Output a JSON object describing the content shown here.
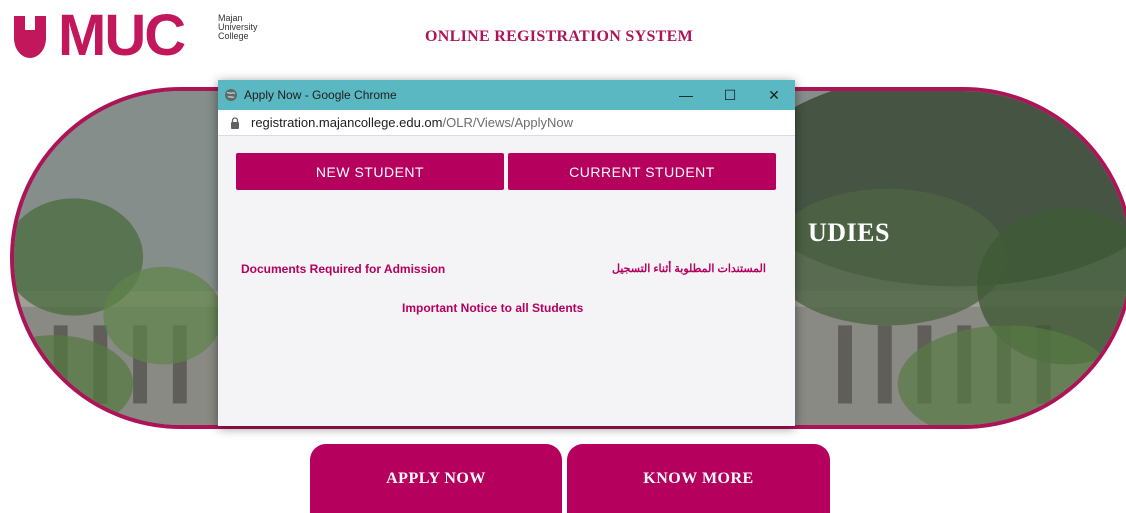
{
  "header": {
    "logo_text": "MUC",
    "logo_sub": [
      "Majan",
      "University",
      "College"
    ],
    "site_title": "ONLINE REGISTRATION SYSTEM"
  },
  "banner": {
    "heading_partial": "UDIES"
  },
  "actions": {
    "apply_label": "APPLY NOW",
    "know_more_label": "KNOW MORE"
  },
  "popup": {
    "window_title": "Apply Now - Google Chrome",
    "url_host": "registration.majancollege.edu.om",
    "url_path": "/OLR/Views/ApplyNow",
    "new_student_label": "NEW STUDENT",
    "current_student_label": "CURRENT STUDENT",
    "docs_link": "Documents Required for Admission",
    "arabic_link": "المستندات المطلوبة أثناء التسجيل",
    "notice_link": "Important Notice to all Students",
    "controls": {
      "minimize": "—",
      "maximize": "☐",
      "close": "✕"
    }
  },
  "colors": {
    "brand": "#b5005e",
    "brand_dark": "#ad1457",
    "titlebar": "#5ab8c2"
  },
  "icons": {
    "globe": "globe-icon",
    "lock": "lock-icon",
    "shield": "logo-shield-icon"
  }
}
